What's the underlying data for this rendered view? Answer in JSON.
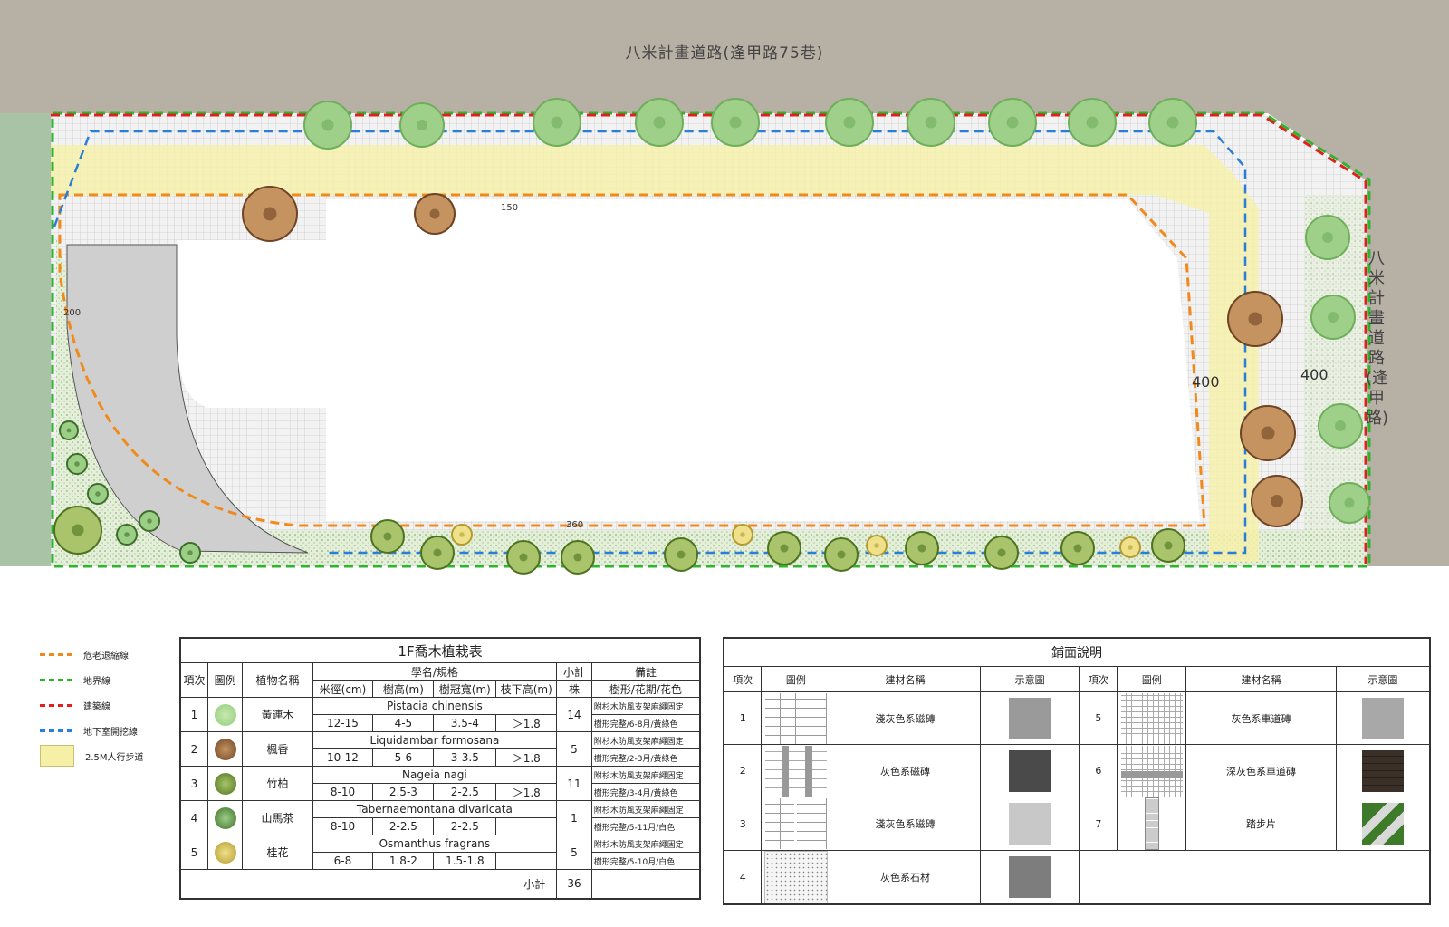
{
  "roads": {
    "top": "八米計畫道路(逢甲路75巷)",
    "right": "八米計畫道路(逢甲路)"
  },
  "dimensions": [
    "400",
    "400",
    "150",
    "200",
    "360"
  ],
  "legend": [
    {
      "label": "危老退縮線",
      "color": "#f08a1c",
      "style": "dashed"
    },
    {
      "label": "地界線",
      "color": "#2db52d",
      "style": "dashed"
    },
    {
      "label": "建築線",
      "color": "#e02020",
      "style": "dashed"
    },
    {
      "label": "地下室開挖線",
      "color": "#2a7ed8",
      "style": "dashed"
    },
    {
      "label": "2.5M人行步道",
      "color": "#f6f0a6",
      "style": "fill"
    }
  ],
  "planting_table": {
    "title": "1F喬木植栽表",
    "headers": {
      "no": "項次",
      "icon": "圖例",
      "name": "植物名稱",
      "spec": "學名/規格",
      "qty": "小計",
      "remark": "備註",
      "dbh": "米徑(cm)",
      "height": "樹高(m)",
      "crown": "樹冠寬(m)",
      "branch": "枝下高(m)",
      "unit": "株",
      "remark_sub": "樹形/花期/花色"
    },
    "rows": [
      {
        "no": "1",
        "name": "黃連木",
        "sci": "Pistacia chinensis",
        "dbh": "12-15",
        "height": "4-5",
        "crown": "3.5-4",
        "branch": "＞1.8",
        "qty": "14",
        "note1": "附杉木防風支架麻繩固定",
        "note2": "樹形完整/6-8月/黃綠色",
        "color": "#8fcf7a"
      },
      {
        "no": "2",
        "name": "楓香",
        "sci": "Liquidambar formosana",
        "dbh": "10-12",
        "height": "5-6",
        "crown": "3-3.5",
        "branch": "＞1.8",
        "qty": "5",
        "note1": "附杉木防風支架麻繩固定",
        "note2": "樹形完整/2-3月/黃綠色",
        "color": "#8a5a33"
      },
      {
        "no": "3",
        "name": "竹柏",
        "sci": "Nageia nagi",
        "dbh": "8-10",
        "height": "2.5-3",
        "crown": "2-2.5",
        "branch": "＞1.8",
        "qty": "11",
        "note1": "附杉木防風支架麻繩固定",
        "note2": "樹形完整/3-4月/黃綠色",
        "color": "#5e8a2c"
      },
      {
        "no": "4",
        "name": "山馬茶",
        "sci": "Tabernaemontana divaricata",
        "dbh": "8-10",
        "height": "2-2.5",
        "crown": "2-2.5",
        "branch": "",
        "qty": "1",
        "note1": "附杉木防風支架麻繩固定",
        "note2": "樹形完整/5-11月/白色",
        "color": "#4f8a3a"
      },
      {
        "no": "5",
        "name": "桂花",
        "sci": "Osmanthus fragrans",
        "dbh": "6-8",
        "height": "1.8-2",
        "crown": "1.5-1.8",
        "branch": "",
        "qty": "5",
        "note1": "附杉木防風支架麻繩固定",
        "note2": "樹形完整/5-10月/白色",
        "color": "#c9b84a"
      }
    ],
    "total_label": "小計",
    "total": "36"
  },
  "paving_table": {
    "title": "鋪面說明",
    "headers": {
      "no": "項次",
      "icon": "圖例",
      "name": "建材名稱",
      "sample": "示意圖"
    },
    "left": [
      {
        "no": "1",
        "name": "淺灰色系磁磚"
      },
      {
        "no": "2",
        "name": "灰色系磁磚"
      },
      {
        "no": "3",
        "name": "淺灰色系磁磚"
      },
      {
        "no": "4",
        "name": "灰色系石材"
      }
    ],
    "right": [
      {
        "no": "5",
        "name": "灰色系車道磚"
      },
      {
        "no": "6",
        "name": "深灰色系車道磚"
      },
      {
        "no": "7",
        "name": "踏步片"
      }
    ]
  }
}
